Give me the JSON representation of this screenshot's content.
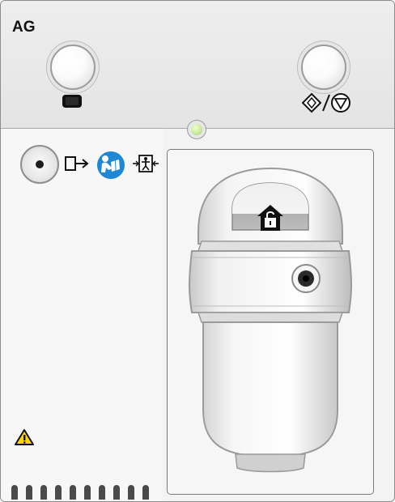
{
  "module": {
    "title": "AG"
  },
  "buttons": {
    "left_icon": "display-screen-icon",
    "right_icon": "start-stop-icon"
  },
  "status_led": {
    "color": "#c8e89a"
  },
  "connector_panel": {
    "icons": [
      "gas-port-icon",
      "gas-outlet-icon",
      "follow-instructions-icon",
      "defibrillation-proof-type-bf-icon",
      "warning-icon"
    ]
  },
  "water_trap": {
    "lock_icon": "unlock-home-icon"
  },
  "colors": {
    "accent_blue": "#1e88d6",
    "warning_yellow": "#ffd400"
  }
}
